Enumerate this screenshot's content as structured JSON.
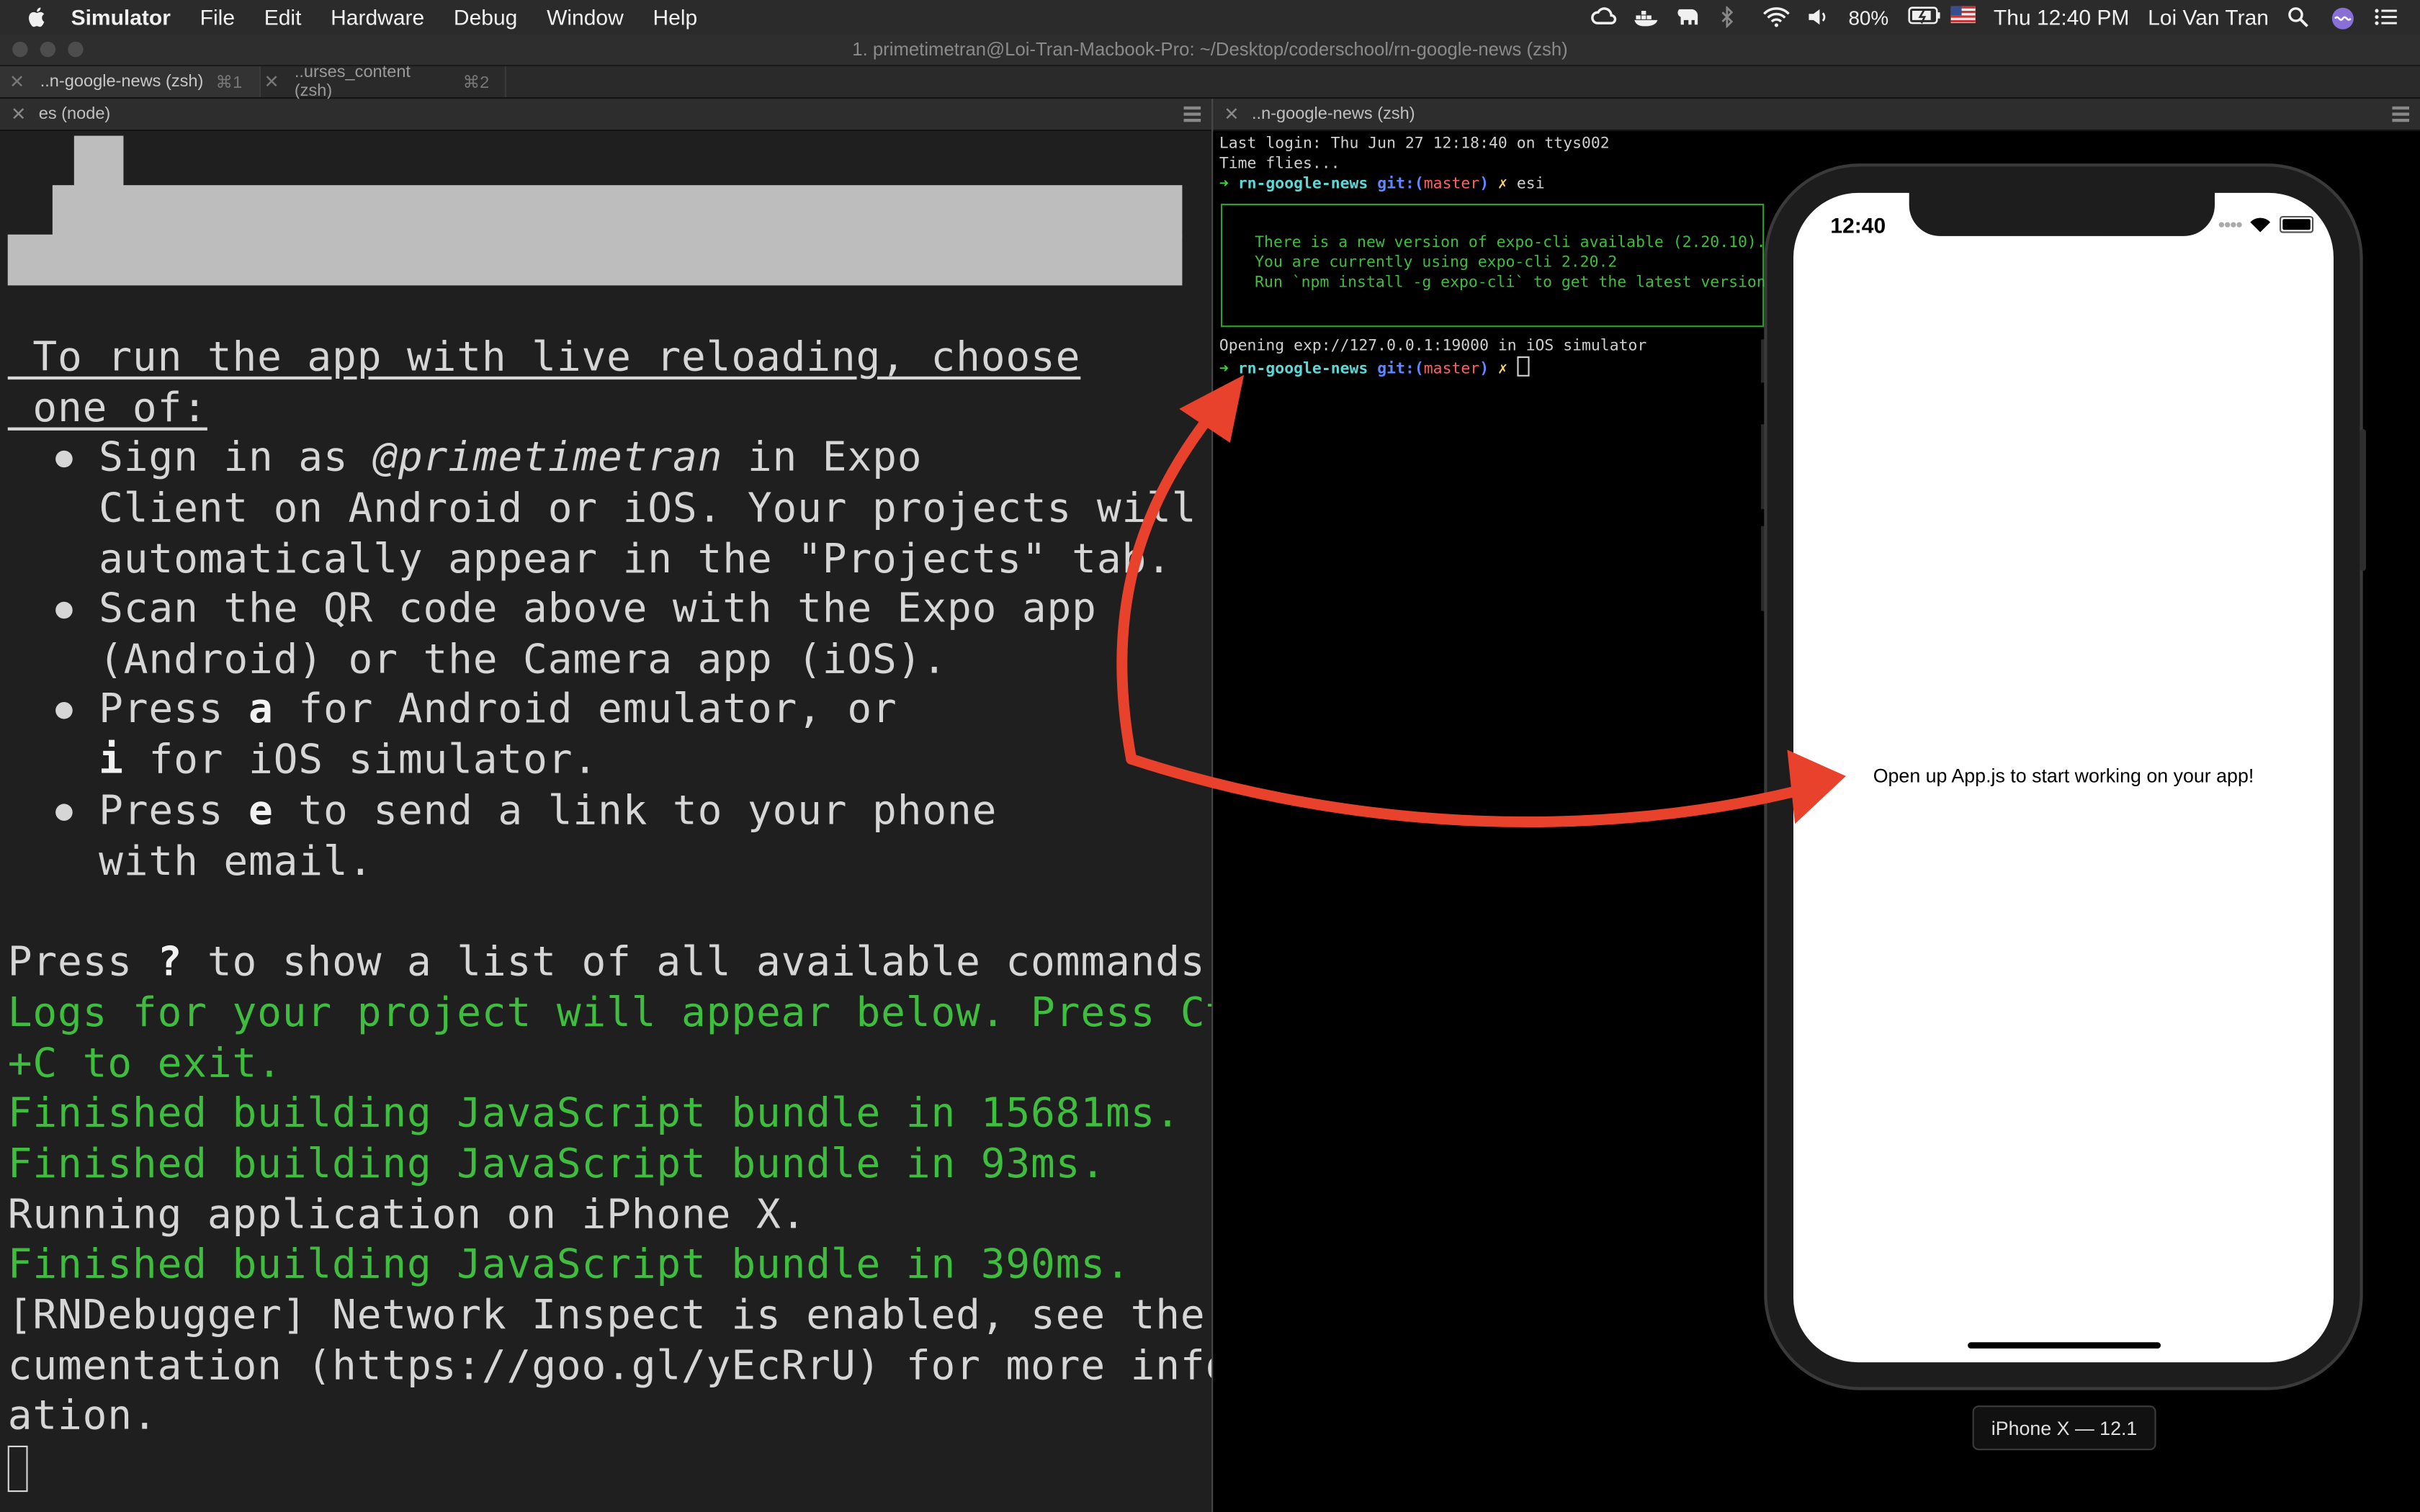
{
  "menubar": {
    "app_name": "Simulator",
    "menus": [
      "File",
      "Edit",
      "Hardware",
      "Debug",
      "Window",
      "Help"
    ],
    "battery": "80%",
    "clock": "Thu 12:40 PM",
    "user": "Loi Van Tran"
  },
  "window": {
    "title": "1. primetimetran@Loi-Tran-Macbook-Pro: ~/Desktop/coderschool/rn-google-news (zsh)"
  },
  "tabs": [
    {
      "label": "..n-google-news (zsh)",
      "shortcut": "⌘1"
    },
    {
      "label": "..urses_content (zsh)",
      "shortcut": "⌘2"
    }
  ],
  "left_pane": {
    "header": "es (node)",
    "intro_line1": " To run the app with live reloading, choose",
    "intro_line2": " one of:",
    "b1_l1a": "Sign in as ",
    "b1_user": "@primetimetran",
    "b1_l1b": " in Expo",
    "b1_l2": "Client on Android or iOS. Your projects will",
    "b1_l3": "automatically appear in the \"Projects\" tab.",
    "b2_l1": "Scan the QR code above with the Expo app",
    "b2_l2": "(Android) or the Camera app (iOS).",
    "b3_l1a": "Press ",
    "b3_key1": "a",
    "b3_l1b": " for Android emulator, or",
    "b3_key2": "i",
    "b3_l2b": " for iOS simulator.",
    "b4_l1a": "Press ",
    "b4_key": "e",
    "b4_l1b": " to send a link to your phone",
    "b4_l2": "with email.",
    "help_a": "Press ",
    "help_key": "?",
    "help_b": " to show a list of all available commands.",
    "logs_l1": "Logs for your project will appear below. Press Ctrl",
    "logs_l2": "+C to exit.",
    "fin1": "Finished building JavaScript bundle in 15681ms.",
    "fin2": "Finished building JavaScript bundle in 93ms.",
    "running": "Running application on iPhone X.",
    "fin3": "Finished building JavaScript bundle in 390ms.",
    "rnd_l1": "[RNDebugger] Network Inspect is enabled, see the do",
    "rnd_l2": "cumentation (https://goo.gl/yEcRrU) for more inform",
    "rnd_l3": "ation."
  },
  "right_pane": {
    "header": "..n-google-news (zsh)",
    "last_login": "Last login: Thu Jun 27 12:18:40 on ttys002",
    "time_flies": "Time flies...",
    "prompt_arrow": "➜",
    "prompt_dir": "rn-google-news",
    "prompt_git": "git:(",
    "prompt_branch": "master",
    "prompt_git_close": ")",
    "prompt_x": "✗",
    "command": "esi",
    "notice_l1": "There is a new version of expo-cli available (2.20.10).",
    "notice_l2": "You are currently using expo-cli 2.20.2",
    "notice_l3": "Run `npm install -g expo-cli` to get the latest version",
    "opening": "Opening exp://127.0.0.1:19000 in iOS simulator"
  },
  "simulator": {
    "status_time": "12:40",
    "app_text": "Open up App.js to start working on your app!",
    "device_label": "iPhone X — 12.1"
  },
  "colors": {
    "annotation_arrow": "#e8412c",
    "terminal_green": "#3fbd3f"
  }
}
